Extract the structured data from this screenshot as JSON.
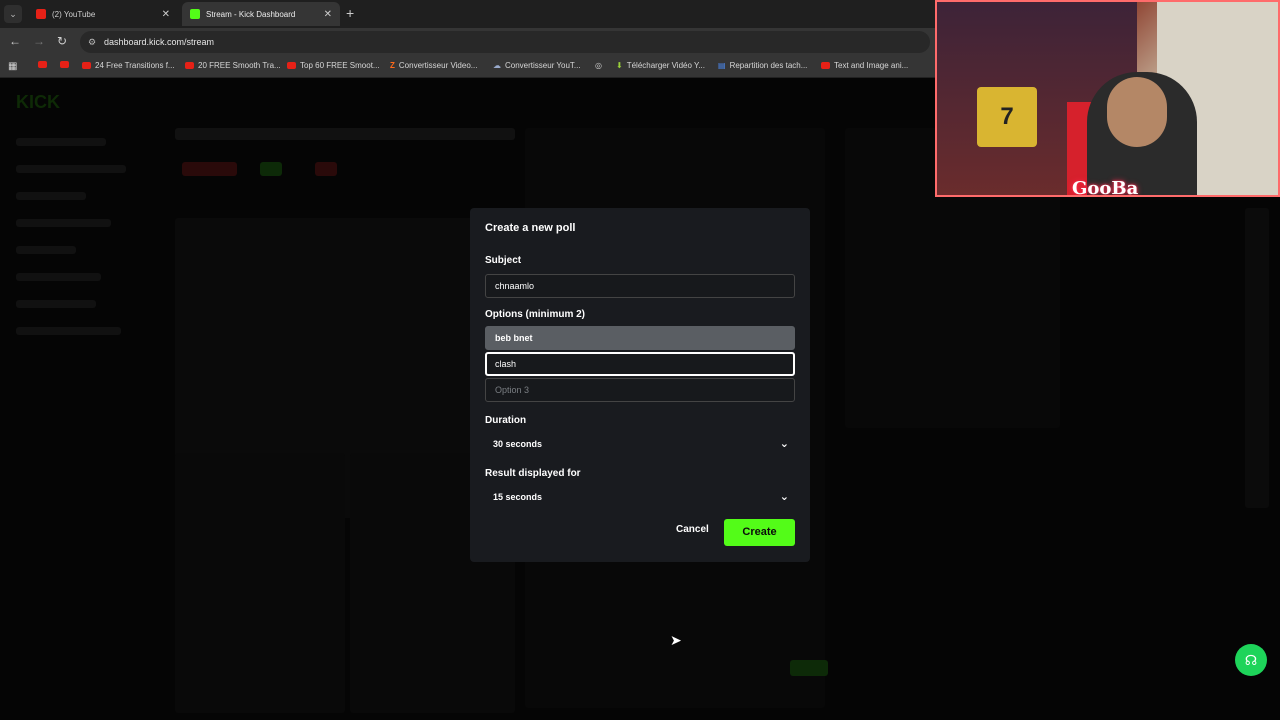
{
  "browser": {
    "tabs": [
      {
        "label": "(2) YouTube"
      },
      {
        "label": "Stream - Kick Dashboard"
      }
    ],
    "url": "dashboard.kick.com/stream",
    "bookmarks": [
      {
        "label": ""
      },
      {
        "label": ""
      },
      {
        "label": "24 Free Transitions f..."
      },
      {
        "label": "20 FREE Smooth Tra..."
      },
      {
        "label": "Top 60 FREE Smoot..."
      },
      {
        "label": "Convertisseur Video..."
      },
      {
        "label": "Convertisseur YouT..."
      },
      {
        "label": ""
      },
      {
        "label": "Télécharger Vidéo Y..."
      },
      {
        "label": "Repartition des tach..."
      },
      {
        "label": "Text and Image ani..."
      }
    ]
  },
  "webcam": {
    "jersey_number": "7",
    "overlay_logo": "GooBa"
  },
  "modal": {
    "title": "Create a new poll",
    "subject_label": "Subject",
    "subject_value": "chnaamlo",
    "options_label": "Options (minimum 2)",
    "options": [
      {
        "value": "beb bnet"
      },
      {
        "value": "clash"
      },
      {
        "value": "",
        "placeholder": "Option 3"
      }
    ],
    "duration_label": "Duration",
    "duration_value": "30 seconds",
    "result_label": "Result displayed for",
    "result_value": "15 seconds",
    "cancel_label": "Cancel",
    "create_label": "Create"
  },
  "colors": {
    "accent": "#53fc18",
    "modal_bg": "#191b1f",
    "page_bg": "#050505"
  }
}
